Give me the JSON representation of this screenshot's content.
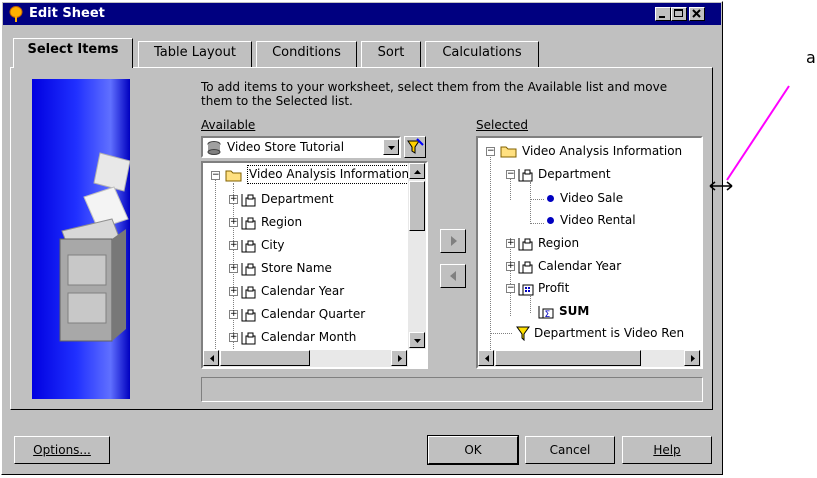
{
  "window": {
    "title": "Edit Sheet"
  },
  "tabs": [
    {
      "label": "Select Items"
    },
    {
      "label": "Table Layout"
    },
    {
      "label": "Conditions"
    },
    {
      "label": "Sort"
    },
    {
      "label": "Calculations"
    }
  ],
  "hint": "To add items to your worksheet, select them from the Available list and move them to the Selected list.",
  "available": {
    "label": "Available",
    "dropdown_value": "Video Store Tutorial",
    "tree_root": "Video Analysis Information",
    "items": [
      "Department",
      "Region",
      "City",
      "Store Name",
      "Calendar Year",
      "Calendar Quarter",
      "Calendar Month"
    ]
  },
  "selected": {
    "label": "Selected",
    "root": "Video Analysis Information",
    "department": "Department",
    "department_children": [
      "Video Sale",
      "Video Rental"
    ],
    "region": "Region",
    "calendar_year": "Calendar Year",
    "profit": "Profit",
    "profit_child": "SUM",
    "condition": "Department is Video Ren"
  },
  "buttons": {
    "options": "Options...",
    "ok": "OK",
    "cancel": "Cancel",
    "help": "Help"
  },
  "annotation": {
    "label": "a",
    "color": "#ff00ff"
  }
}
